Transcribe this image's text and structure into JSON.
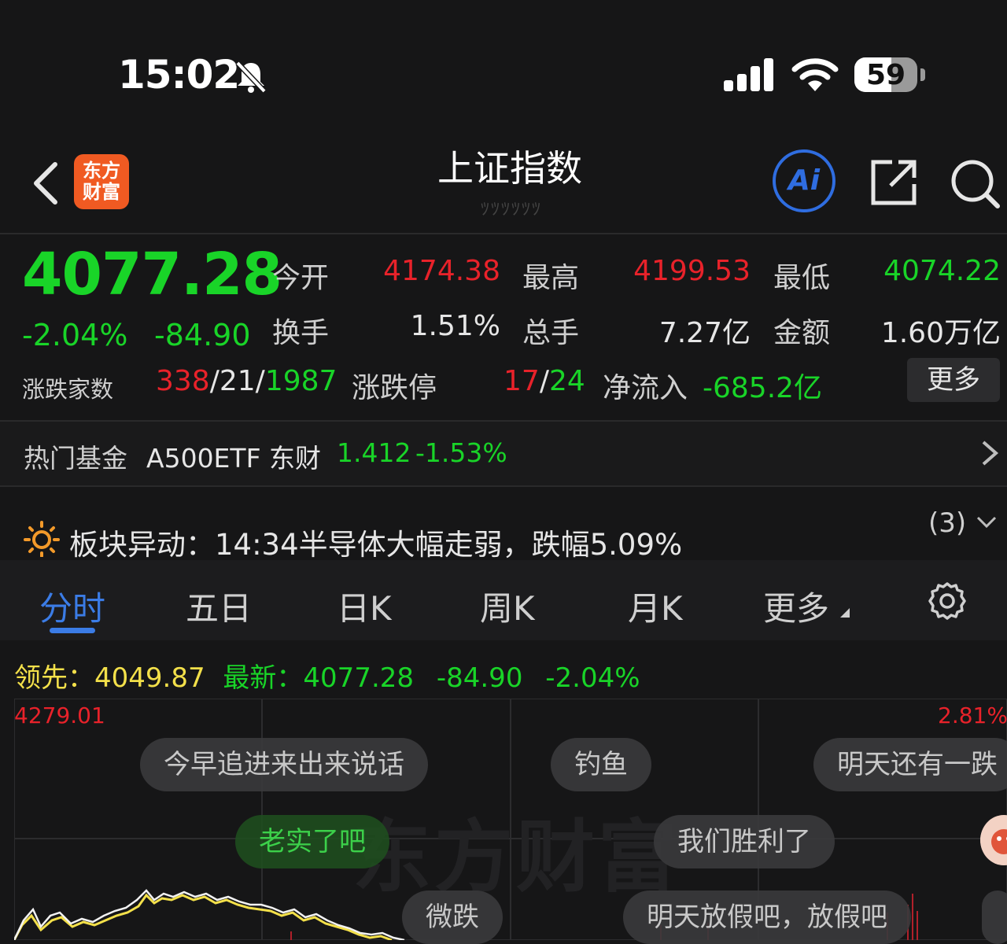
{
  "status_bar": {
    "time": "15:02",
    "battery": "59"
  },
  "header": {
    "logo_text_line1": "东方",
    "logo_text_line2": "财富",
    "title": "上证指数",
    "subtitle": "ﾂﾂﾂﾂﾂﾂ",
    "ai_label": "Ai"
  },
  "quote": {
    "price": "4077.28",
    "change_pct": "-2.04%",
    "change_val": "-84.90",
    "open_label": "今开",
    "open": "4174.38",
    "high_label": "最高",
    "high": "4199.53",
    "low_label": "最低",
    "low": "4074.22",
    "turnover_label": "换手",
    "turnover": "1.51%",
    "volume_label": "总手",
    "volume": "7.27亿",
    "amount_label": "金额",
    "amount": "1.60万亿",
    "breadth_label": "涨跌家数",
    "breadth_up": "338",
    "breadth_flat": "21",
    "breadth_down": "1987",
    "limit_label": "涨跌停",
    "limit_up": "17",
    "limit_down": "24",
    "netflow_label": "净流入",
    "netflow": "-685.2亿",
    "more": "更多"
  },
  "hot_fund": {
    "label": "热门基金",
    "name": "A500ETF 东财",
    "price": "1.412",
    "change": "-1.53%"
  },
  "alert": {
    "text": "板块异动：14:34半导体大幅走弱，跌幅5.09%",
    "count": "(3)"
  },
  "tabs": [
    "分时",
    "五日",
    "日K",
    "周K",
    "月K",
    "更多"
  ],
  "legend": {
    "lead_label": "领先：",
    "lead": "4049.87",
    "latest_label": "最新：",
    "latest": "4077.28",
    "change": "-84.90",
    "pct": "-2.04%"
  },
  "chart": {
    "max": "4279.01",
    "max_pct": "2.81%",
    "watermark": "东方财富"
  },
  "danmaku": [
    "今早追进来出来说话",
    "钓鱼",
    "明天还有一跌",
    "老实了吧",
    "我们胜利了",
    "微跌",
    "明天放假吧，放假吧"
  ],
  "colors": {
    "up": "#e8222a",
    "down": "#19d428",
    "accent": "#3b7ce6",
    "lead": "#f3e04a"
  }
}
